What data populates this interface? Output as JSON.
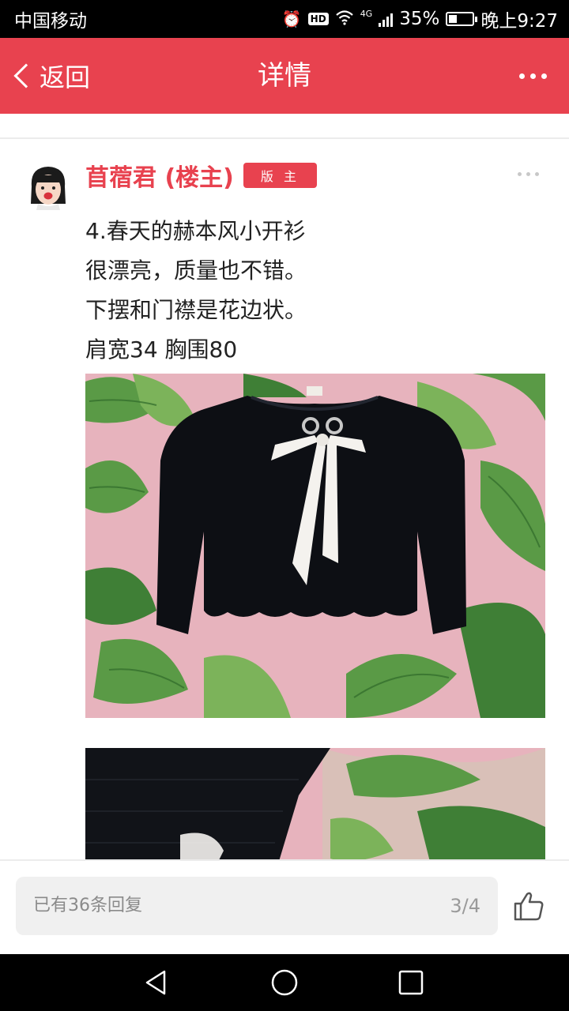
{
  "status_bar": {
    "carrier": "中国移动",
    "network_type": "4G",
    "hd_label": "HD",
    "battery_percent": "35%",
    "battery_level": 0.35,
    "time": "晚上9:27"
  },
  "app_bar": {
    "back_label": "返回",
    "title": "详情"
  },
  "post": {
    "author": "苜蓿君 (楼主)",
    "badge": "版 主",
    "lines": [
      "4.春天的赫本风小开衫",
      "很漂亮，质量也不错。",
      "下摆和门襟是花边状。",
      "肩宽34 胸围80"
    ]
  },
  "bottom_bar": {
    "reply_text": "已有36条回复",
    "page_indicator": "3/4"
  },
  "colors": {
    "accent": "#e8424f",
    "cardigan": "#0d0f14",
    "bow": "#f4f2ee",
    "leaf_green": "#5a9a46",
    "pink_background": "#e7b3bd"
  },
  "icons": {
    "back": "chevron-left-icon",
    "more": "more-dots-icon",
    "like": "thumbs-up-icon",
    "nav_back": "triangle-back-icon",
    "nav_home": "circle-home-icon",
    "nav_recent": "square-recent-icon"
  }
}
